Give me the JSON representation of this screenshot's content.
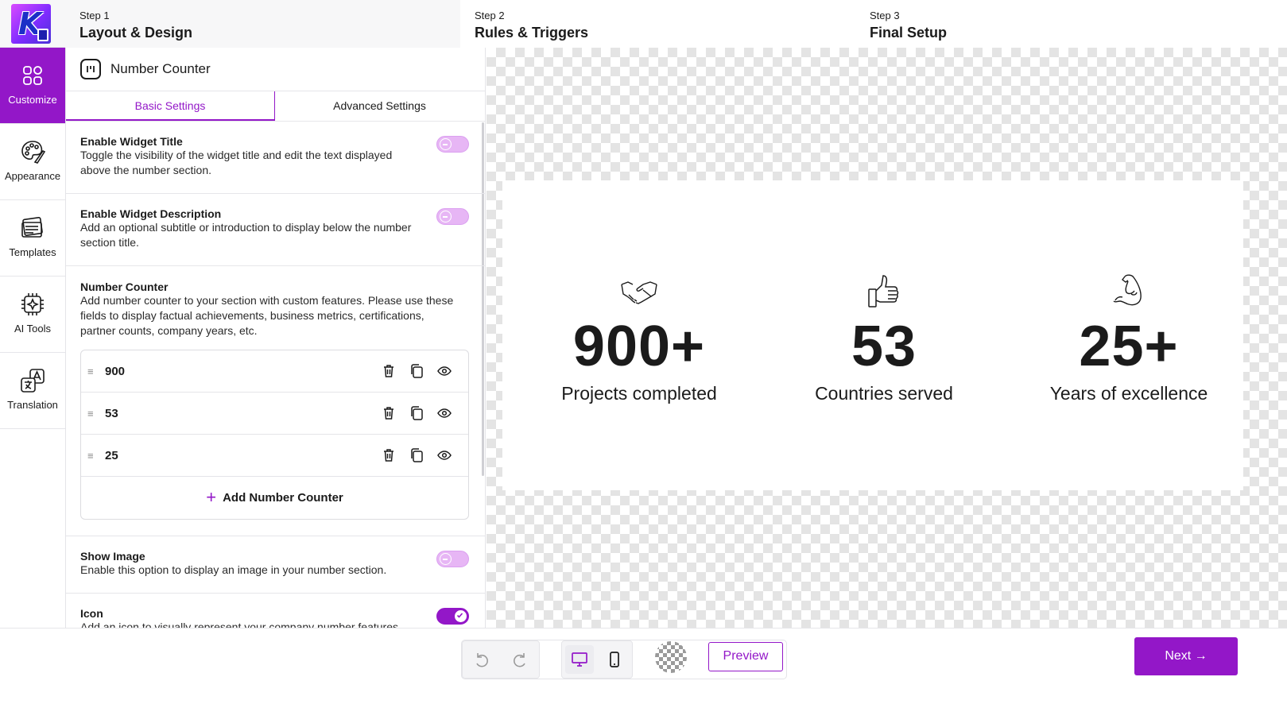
{
  "app": {
    "logo_letter": "K"
  },
  "steps": [
    {
      "label": "Step 1",
      "title": "Layout & Design"
    },
    {
      "label": "Step 2",
      "title": "Rules & Triggers"
    },
    {
      "label": "Step 3",
      "title": "Final Setup"
    }
  ],
  "sidebar": {
    "items": [
      {
        "label": "Customize",
        "icon": "customize-icon",
        "active": true
      },
      {
        "label": "Appearance",
        "icon": "palette-icon"
      },
      {
        "label": "Templates",
        "icon": "templates-icon"
      },
      {
        "label": "AI Tools",
        "icon": "ai-chip-icon"
      },
      {
        "label": "Translation",
        "icon": "translation-icon"
      }
    ]
  },
  "panel": {
    "title": "Number Counter",
    "tabs": [
      {
        "label": "Basic Settings",
        "active": true
      },
      {
        "label": "Advanced Settings"
      }
    ],
    "settings": {
      "widget_title": {
        "title": "Enable Widget Title",
        "description": "Toggle the visibility of the widget title and edit the text displayed above the number section.",
        "enabled": false
      },
      "widget_description": {
        "title": "Enable Widget Description",
        "description": "Add an optional subtitle or introduction to display below the number section title.",
        "enabled": false
      },
      "number_counter": {
        "title": "Number Counter",
        "description": "Add number counter to your section with custom features. Please use these fields to display factual achievements, business metrics, certifications, partner counts, company years, etc.",
        "items": [
          "900",
          "53",
          "25"
        ],
        "add_label": "Add Number Counter"
      },
      "show_image": {
        "title": "Show Image",
        "description": "Enable this option to display an image in your number section.",
        "enabled": false
      },
      "icon": {
        "title": "Icon",
        "description": "Add an icon to visually represent your company number features.",
        "enabled": true
      }
    }
  },
  "preview": {
    "stats": [
      {
        "number": "900+",
        "caption": "Projects completed",
        "icon": "handshake-icon"
      },
      {
        "number": "53",
        "caption": "Countries served",
        "icon": "thumbs-up-icon"
      },
      {
        "number": "25+",
        "caption": "Years of excellence",
        "icon": "flexed-arm-icon"
      }
    ]
  },
  "bottom": {
    "preview_label": "Preview",
    "next_label": "Next →"
  },
  "colors": {
    "accent": "#9317c8",
    "toggle_off": "#e7b6f5"
  }
}
